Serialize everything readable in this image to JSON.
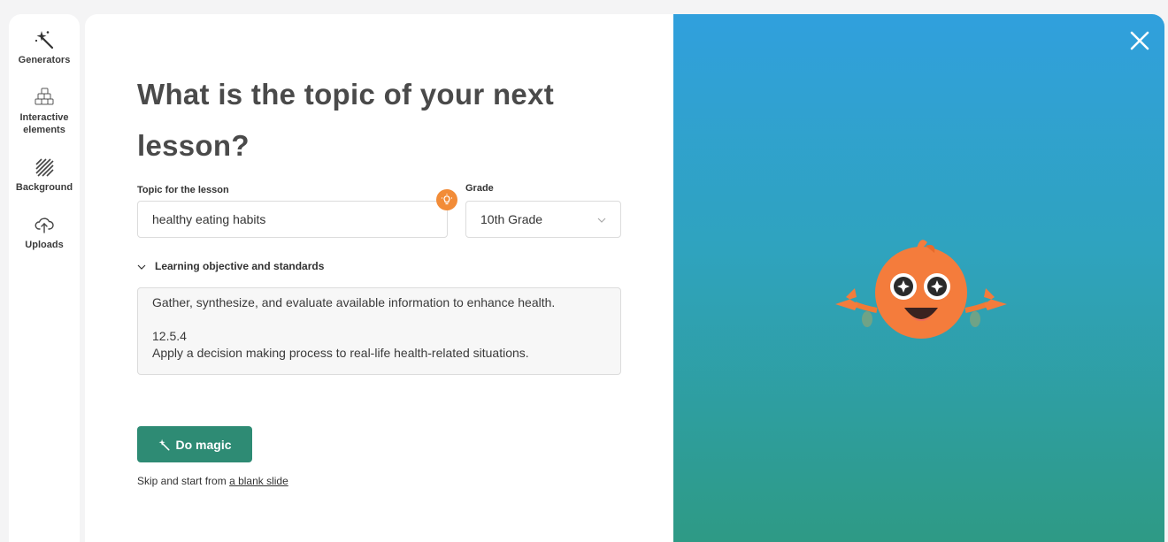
{
  "sidebar": {
    "items": [
      {
        "label": "Generators",
        "icon": "magic-wand-icon"
      },
      {
        "label": "Interactive elements",
        "icon": "blocks-icon"
      },
      {
        "label": "Background",
        "icon": "hatch-pattern-icon"
      },
      {
        "label": "Uploads",
        "icon": "cloud-upload-icon"
      }
    ]
  },
  "main": {
    "title": "What is the topic of your next lesson?",
    "topic": {
      "label": "Topic for the lesson",
      "value": "healthy eating habits"
    },
    "grade": {
      "label": "Grade",
      "value": "10th Grade"
    },
    "objective": {
      "toggle_label": "Learning objective and standards",
      "line1": "Gather, synthesize, and evaluate available information to enhance health.",
      "line2": "12.5.4",
      "line3": "Apply a decision making process to real-life health-related situations."
    },
    "magic_button": "Do magic",
    "skip_text": "Skip and start from",
    "skip_link": "a blank slide"
  },
  "colors": {
    "accent": "#2e8b74",
    "bulb": "#f28c38",
    "gradient_top": "#30a0dd",
    "gradient_bottom": "#2e9a85"
  }
}
